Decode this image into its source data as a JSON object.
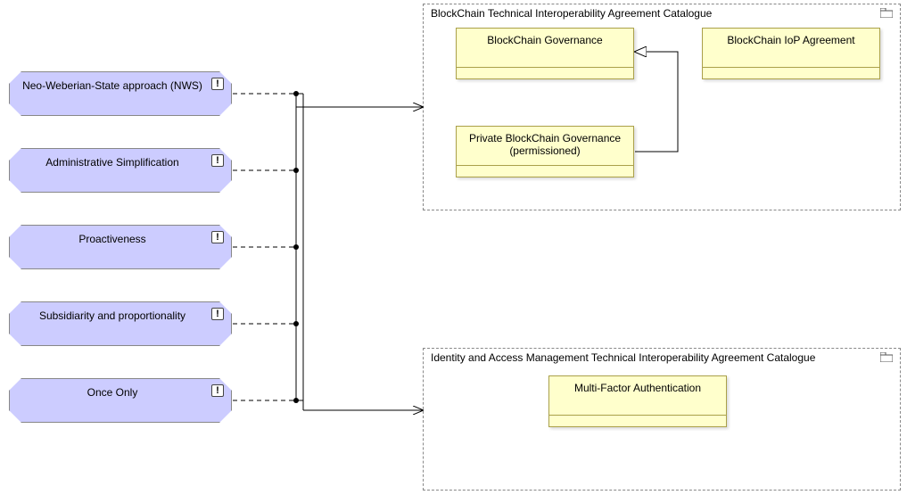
{
  "principles": [
    {
      "label": "Neo-Weberian-State approach (NWS)"
    },
    {
      "label": "Administrative Simplification"
    },
    {
      "label": "Proactiveness"
    },
    {
      "label": "Subsidiarity and proportionality"
    },
    {
      "label": "Once Only"
    }
  ],
  "catalogues": [
    {
      "title": "BlockChain Technical Interoperability Agreement Catalogue",
      "contracts": [
        {
          "name": "BlockChain Governance"
        },
        {
          "name": "Private BlockChain Governance (permissioned)"
        },
        {
          "name": "BlockChain IoP Agreement"
        }
      ]
    },
    {
      "title": "Identity and Access Management Technical Interoperability Agreement Catalogue",
      "contracts": [
        {
          "name": "Multi-Factor Authentication"
        }
      ]
    }
  ],
  "chart_data": {
    "type": "diagram",
    "notation": "ArchiMate-like",
    "left_elements": [
      "Neo-Weberian-State approach (NWS)",
      "Administrative Simplification",
      "Proactiveness",
      "Subsidiarity and proportionality",
      "Once Only"
    ],
    "left_element_type": "Principle",
    "right_groups": [
      {
        "name": "BlockChain Technical Interoperability Agreement Catalogue",
        "elements": [
          "BlockChain Governance",
          "BlockChain IoP Agreement",
          "Private BlockChain Governance (permissioned)"
        ],
        "internal_relations": [
          {
            "from": "Private BlockChain Governance (permissioned)",
            "to": "BlockChain Governance",
            "type": "generalization"
          }
        ]
      },
      {
        "name": "Identity and Access Management Technical Interoperability Agreement Catalogue",
        "elements": [
          "Multi-Factor Authentication"
        ]
      }
    ],
    "cross_relations": [
      {
        "from_all_of": "left_elements",
        "to": "BlockChain Technical Interoperability Agreement Catalogue",
        "type": "dashed-to-solid-arrow"
      },
      {
        "from_all_of": "left_elements",
        "to": "Identity and Access Management Technical Interoperability Agreement Catalogue",
        "type": "dashed-to-solid-arrow"
      }
    ]
  }
}
